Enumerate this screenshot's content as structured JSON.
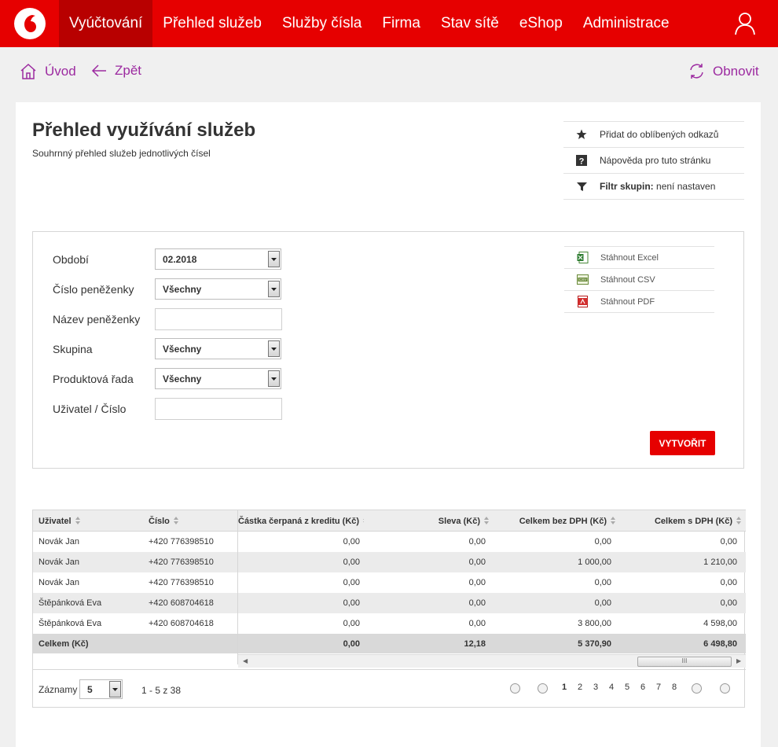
{
  "nav": {
    "items": [
      "Vyúčtování",
      "Přehled služeb",
      "Služby čísla",
      "Firma",
      "Stav sítě",
      "eShop",
      "Administrace"
    ],
    "active_index": 0,
    "brand_color": "#e60000"
  },
  "subbar": {
    "home_label": "Úvod",
    "back_label": "Zpět",
    "refresh_label": "Obnovit"
  },
  "page": {
    "title": "Přehled využívání služeb",
    "subtitle": "Souhrnný přehled služeb jednotlivých čísel"
  },
  "side_links": {
    "favorite": "Přidat do oblíbených odkazů",
    "help": "Nápověda pro tuto stránku",
    "filter_label": "Filtr skupin:",
    "filter_value": "není nastaven"
  },
  "filter": {
    "period_label": "Období",
    "period_value": "02.2018",
    "wallet_number_label": "Číslo peněženky",
    "wallet_number_value": "Všechny",
    "wallet_name_label": "Název peněženky",
    "wallet_name_value": "",
    "group_label": "Skupina",
    "group_value": "Všechny",
    "product_line_label": "Produktová řada",
    "product_line_value": "Všechny",
    "user_label": "Uživatel / Číslo",
    "user_value": "",
    "create_button": "VYTVOŘIT"
  },
  "downloads": {
    "excel": "Stáhnout Excel",
    "csv": "Stáhnout CSV",
    "pdf": "Stáhnout PDF"
  },
  "table": {
    "headers": {
      "user": "Uživatel",
      "number": "Číslo",
      "credit": "Částka čerpaná z kreditu (Kč)",
      "discount": "Sleva (Kč)",
      "total_no_vat": "Celkem bez DPH (Kč)",
      "total_vat": "Celkem s DPH (Kč)"
    },
    "rows": [
      {
        "user": "Novák Jan",
        "number": "+420 776398510",
        "credit": "0,00",
        "discount": "0,00",
        "total_no_vat": "0,00",
        "total_vat": "0,00"
      },
      {
        "user": "Novák Jan",
        "number": "+420 776398510",
        "credit": "0,00",
        "discount": "0,00",
        "total_no_vat": "1 000,00",
        "total_vat": "1 210,00"
      },
      {
        "user": "Novák Jan",
        "number": "+420 776398510",
        "credit": "0,00",
        "discount": "0,00",
        "total_no_vat": "0,00",
        "total_vat": "0,00"
      },
      {
        "user": "Štěpánková Eva",
        "number": "+420 608704618",
        "credit": "0,00",
        "discount": "0,00",
        "total_no_vat": "0,00",
        "total_vat": "0,00"
      },
      {
        "user": "Štěpánková Eva",
        "number": "+420 608704618",
        "credit": "0,00",
        "discount": "0,00",
        "total_no_vat": "3 800,00",
        "total_vat": "4 598,00"
      }
    ],
    "total": {
      "label": "Celkem (Kč)",
      "credit": "0,00",
      "discount": "12,18",
      "total_no_vat": "5 370,90",
      "total_vat": "6 498,80"
    },
    "scroll_thumb_glyph": "III"
  },
  "pager": {
    "records_label": "Záznamy",
    "page_size": "5",
    "range": "1 - 5 z 38",
    "pages": [
      "1",
      "2",
      "3",
      "4",
      "5",
      "6",
      "7",
      "8"
    ],
    "current_page": "1"
  }
}
